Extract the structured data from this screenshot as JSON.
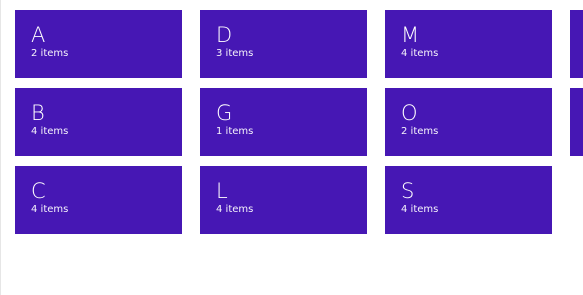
{
  "tile_color": "#4617b4",
  "groups": [
    {
      "letter": "A",
      "count": "2 items"
    },
    {
      "letter": "B",
      "count": "4 items"
    },
    {
      "letter": "C",
      "count": "4 items"
    },
    {
      "letter": "D",
      "count": "3 items"
    },
    {
      "letter": "G",
      "count": "1 items"
    },
    {
      "letter": "L",
      "count": "4 items"
    },
    {
      "letter": "M",
      "count": "4 items"
    },
    {
      "letter": "O",
      "count": "2 items"
    },
    {
      "letter": "S",
      "count": "4 items"
    }
  ]
}
